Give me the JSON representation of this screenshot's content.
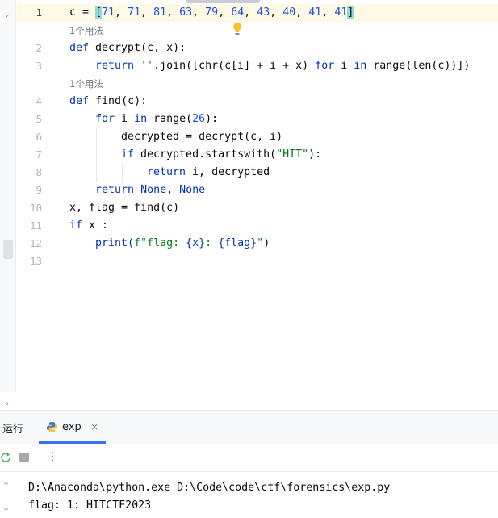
{
  "editor": {
    "line_numbers": [
      "1",
      "2",
      "3",
      "4",
      "5",
      "6",
      "7",
      "8",
      "9",
      "10",
      "11",
      "12",
      "13"
    ],
    "usage_hint": "1个用法",
    "lines": {
      "l1": {
        "var": "c = ",
        "open": "[",
        "nums": [
          "71",
          "71",
          "81",
          "63",
          "79",
          "64",
          "43",
          "40",
          "41",
          "41"
        ],
        "close": "]"
      },
      "l2": {
        "kw": "def ",
        "name": "decrypt",
        "rest": "(c, x):"
      },
      "l3": {
        "kw_return": "return ",
        "str": "''",
        "p1": ".join([chr(c[i] + i + x) ",
        "kw_for": "for",
        "p2": " i ",
        "kw_in": "in",
        "p3": " range(len(c))])"
      },
      "l4": {
        "kw": "def ",
        "name": "find",
        "rest": "(c):"
      },
      "l5": {
        "kw_for": "for",
        "p1": " i ",
        "kw_in": "in",
        "p2": " range(",
        "num": "26",
        "p3": "):"
      },
      "l6": {
        "text": "decrypted = decrypt(c, i)"
      },
      "l7": {
        "kw_if": "if",
        "p1": " decrypted.startswith(",
        "str": "\"HIT\"",
        "p2": "):"
      },
      "l8": {
        "kw_return": "return",
        "p1": " i, decrypted"
      },
      "l9": {
        "kw_return": "return",
        "p1": " ",
        "none1": "None",
        "p2": ", ",
        "none2": "None"
      },
      "l10": {
        "text": "x, flag = find(c)"
      },
      "l11": {
        "kw_if": "if",
        "p1": " x :"
      },
      "l12": {
        "fn": "print(",
        "str1": "f\"flag: ",
        "b1": "{x}",
        "str2": ": ",
        "b2": "{flag}",
        "str3": "\"",
        "p2": ")"
      }
    }
  },
  "toolwindow": {
    "run_label": "运行",
    "tab_label": "exp",
    "tab_close": "×",
    "more": "⋮",
    "console_lines": [
      "D:\\Anaconda\\python.exe D:\\Code\\code\\ctf\\forensics\\exp.py",
      "flag: 1: HITCTF2023"
    ]
  },
  "colors": {
    "keyword": "#0033b3",
    "number": "#1750eb",
    "string": "#067d17",
    "accent": "#3574f0"
  }
}
